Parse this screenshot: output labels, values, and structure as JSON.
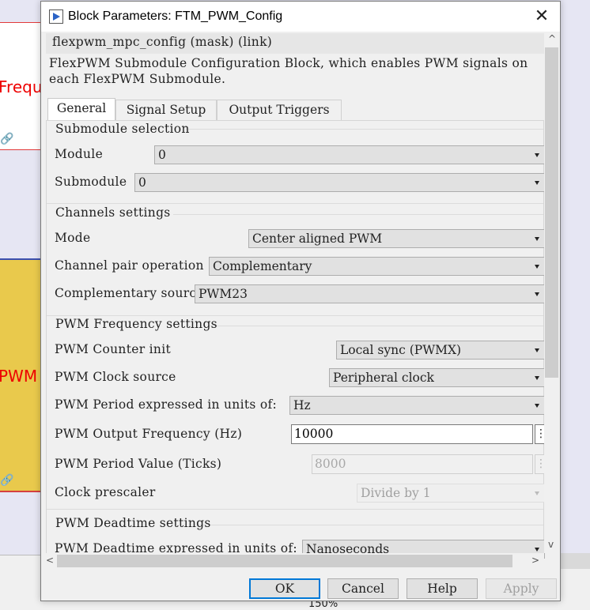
{
  "background": {
    "freq_text": "Frequ",
    "pwm_text": "PWM",
    "zoom": "150%",
    "link_glyph": "🔗"
  },
  "dialog": {
    "title": "Block Parameters: FTM_PWM_Config",
    "mask_header": "flexpwm_mpc_config (mask) (link)",
    "description": "FlexPWM Submodule Configuration Block, which enables PWM signals on each FlexPWM Submodule.",
    "tabs": [
      "General",
      "Signal Setup",
      "Output Triggers"
    ],
    "active_tab": "General",
    "groups": {
      "submodule": {
        "title": "Submodule selection",
        "module_label": "Module",
        "module_value": "0",
        "submodule_label": "Submodule",
        "submodule_value": "0"
      },
      "channels": {
        "title": "Channels settings",
        "mode_label": "Mode",
        "mode_value": "Center aligned PWM",
        "pair_label": "Channel pair operation",
        "pair_value": "Complementary",
        "source_label": "Complementary source",
        "source_value": "PWM23"
      },
      "frequency": {
        "title": "PWM Frequency settings",
        "counter_label": "PWM Counter init",
        "counter_value": "Local sync (PWMX)",
        "clock_label": "PWM Clock source",
        "clock_value": "Peripheral clock",
        "units_label": "PWM Period expressed in units of:",
        "units_value": "Hz",
        "output_freq_label": "PWM Output Frequency (Hz)",
        "output_freq_value": "10000",
        "period_label": "PWM Period Value (Ticks)",
        "period_value": "8000",
        "prescaler_label": "Clock prescaler",
        "prescaler_value": "Divide by 1"
      },
      "deadtime": {
        "title": "PWM Deadtime settings",
        "units_label": "PWM Deadtime expressed in units of:",
        "units_value": "Nanoseconds"
      }
    },
    "buttons": {
      "ok": "OK",
      "cancel": "Cancel",
      "help": "Help",
      "apply": "Apply"
    },
    "icons": {
      "close": "✕",
      "kebab": "⋮",
      "scroll_up": "^",
      "scroll_down": "v",
      "scroll_left": "<",
      "scroll_right": ">"
    }
  }
}
